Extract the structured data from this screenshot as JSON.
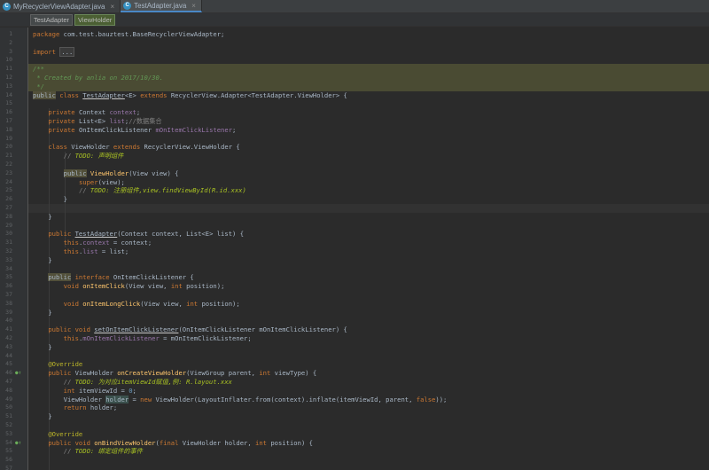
{
  "tabs": [
    {
      "icon": "C",
      "label": "MyRecyclerViewAdapter.java",
      "active": false
    },
    {
      "icon": "C",
      "label": "TestAdapter.java",
      "active": true
    }
  ],
  "breadcrumbs": [
    "TestAdapter",
    "ViewHolder"
  ],
  "lines": [
    {
      "n": "1",
      "code": [
        [
          "kw",
          "package "
        ],
        [
          "",
          "com.test.bauztest.BaseRecyclerViewAdapter;"
        ]
      ]
    },
    {
      "n": "2",
      "code": []
    },
    {
      "n": "3",
      "code": [
        [
          "kw",
          "import "
        ],
        [
          "fold",
          "..."
        ]
      ]
    },
    {
      "n": "10",
      "code": []
    },
    {
      "n": "11",
      "code": [
        [
          "doc",
          "/**"
        ]
      ]
    },
    {
      "n": "12",
      "code": [
        [
          "doc",
          " * Created by anlia on 2017/10/30."
        ]
      ]
    },
    {
      "n": "13",
      "code": [
        [
          "doc",
          " */"
        ]
      ]
    },
    {
      "n": "14",
      "code": [
        [
          "box2",
          "public"
        ],
        [
          "kw",
          " class "
        ],
        [
          "u",
          "TestAdapter"
        ],
        [
          "",
          "<E> "
        ],
        [
          "kw",
          "extends "
        ],
        [
          "",
          "RecyclerView.Adapter<TestAdapter.ViewHolder> {"
        ]
      ]
    },
    {
      "n": "15",
      "code": []
    },
    {
      "n": "16",
      "code": [
        [
          "",
          "    "
        ],
        [
          "kw",
          "private "
        ],
        [
          "",
          "Context "
        ],
        [
          "fld",
          "context"
        ],
        [
          "",
          ";"
        ]
      ]
    },
    {
      "n": "17",
      "code": [
        [
          "",
          "    "
        ],
        [
          "kw",
          "private "
        ],
        [
          "",
          "List<E> "
        ],
        [
          "fld",
          "list"
        ],
        [
          "",
          ";"
        ],
        [
          "cm",
          "//数据集合"
        ]
      ]
    },
    {
      "n": "18",
      "code": [
        [
          "",
          "    "
        ],
        [
          "kw",
          "private "
        ],
        [
          "",
          "OnItemClickListener "
        ],
        [
          "fld",
          "mOnItemClickListener"
        ],
        [
          "",
          ";"
        ]
      ]
    },
    {
      "n": "19",
      "code": []
    },
    {
      "n": "20",
      "code": [
        [
          "",
          "    "
        ],
        [
          "kw",
          "class "
        ],
        [
          "",
          "ViewHolder "
        ],
        [
          "kw",
          "extends "
        ],
        [
          "",
          "RecyclerView.ViewHolder {"
        ]
      ]
    },
    {
      "n": "21",
      "code": [
        [
          "",
          "        "
        ],
        [
          "cm",
          "// "
        ],
        [
          "todo",
          "TODO: 声明组件"
        ]
      ]
    },
    {
      "n": "22",
      "code": []
    },
    {
      "n": "23",
      "code": [
        [
          "",
          "        "
        ],
        [
          "box2",
          "public"
        ],
        [
          "",
          ""
        ],
        [
          "fn",
          " ViewHolder"
        ],
        [
          "",
          "(View view) {"
        ]
      ]
    },
    {
      "n": "24",
      "code": [
        [
          "",
          "            "
        ],
        [
          "kw",
          "super"
        ],
        [
          "",
          "(view);"
        ]
      ]
    },
    {
      "n": "25",
      "code": [
        [
          "",
          "            "
        ],
        [
          "cm",
          "// "
        ],
        [
          "todo",
          "TODO: 注册组件,view.findViewById(R.id.xxx)"
        ]
      ]
    },
    {
      "n": "26",
      "code": [
        [
          "",
          "        }"
        ]
      ]
    },
    {
      "n": "27",
      "code": []
    },
    {
      "n": "28",
      "code": [
        [
          "",
          "    }"
        ]
      ]
    },
    {
      "n": "29",
      "code": []
    },
    {
      "n": "30",
      "code": [
        [
          "",
          "    "
        ],
        [
          "kw",
          "public "
        ],
        [
          "u",
          "TestAdapter"
        ],
        [
          "",
          "(Context context, List<E> list) {"
        ]
      ]
    },
    {
      "n": "31",
      "code": [
        [
          "",
          "        "
        ],
        [
          "kw",
          "this"
        ],
        [
          "",
          "."
        ],
        [
          "fld",
          "context"
        ],
        [
          "",
          " = context;"
        ]
      ]
    },
    {
      "n": "32",
      "code": [
        [
          "",
          "        "
        ],
        [
          "kw",
          "this"
        ],
        [
          "",
          "."
        ],
        [
          "fld",
          "list"
        ],
        [
          "",
          " = list;"
        ]
      ]
    },
    {
      "n": "33",
      "code": [
        [
          "",
          "    }"
        ]
      ]
    },
    {
      "n": "34",
      "code": []
    },
    {
      "n": "35",
      "code": [
        [
          "",
          "    "
        ],
        [
          "box2",
          "public"
        ],
        [
          "kw",
          " interface "
        ],
        [
          "",
          "OnItemClickListener {"
        ]
      ]
    },
    {
      "n": "36",
      "code": [
        [
          "",
          "        "
        ],
        [
          "kw",
          "void "
        ],
        [
          "fn",
          "onItemClick"
        ],
        [
          "",
          "(View view, "
        ],
        [
          "kw",
          "int "
        ],
        [
          "",
          "position);"
        ]
      ]
    },
    {
      "n": "37",
      "code": []
    },
    {
      "n": "38",
      "code": [
        [
          "",
          "        "
        ],
        [
          "kw",
          "void "
        ],
        [
          "fn",
          "onItemLongClick"
        ],
        [
          "",
          "(View view, "
        ],
        [
          "kw",
          "int "
        ],
        [
          "",
          "position);"
        ]
      ]
    },
    {
      "n": "39",
      "code": [
        [
          "",
          "    }"
        ]
      ]
    },
    {
      "n": "40",
      "code": []
    },
    {
      "n": "41",
      "code": [
        [
          "",
          "    "
        ],
        [
          "kw",
          "public void "
        ],
        [
          "u",
          "setOnItemClickListener"
        ],
        [
          "",
          "(OnItemClickListener mOnItemClickListener) {"
        ]
      ]
    },
    {
      "n": "42",
      "code": [
        [
          "",
          "        "
        ],
        [
          "kw",
          "this"
        ],
        [
          "",
          "."
        ],
        [
          "fld",
          "mOnItemClickListener"
        ],
        [
          "",
          " = mOnItemClickListener;"
        ]
      ]
    },
    {
      "n": "43",
      "code": [
        [
          "",
          "    }"
        ]
      ]
    },
    {
      "n": "44",
      "code": []
    },
    {
      "n": "45",
      "code": [
        [
          "",
          "    "
        ],
        [
          "an",
          "@Override"
        ]
      ]
    },
    {
      "n": "46",
      "code": [
        [
          "",
          "    "
        ],
        [
          "kw",
          "public "
        ],
        [
          "",
          "ViewHolder "
        ],
        [
          "fn",
          "onCreateViewHolder"
        ],
        [
          "",
          "(ViewGroup parent, "
        ],
        [
          "kw",
          "int "
        ],
        [
          "",
          "viewType) {"
        ]
      ]
    },
    {
      "n": "47",
      "code": [
        [
          "",
          "        "
        ],
        [
          "cm",
          "// "
        ],
        [
          "todo",
          "TODO: 为对应itemViewId赋值,例: R.layout.xxx"
        ]
      ]
    },
    {
      "n": "48",
      "code": [
        [
          "",
          "        "
        ],
        [
          "kw",
          "int "
        ],
        [
          "",
          "itemViewId = "
        ],
        [
          "num",
          "0"
        ],
        [
          "",
          ";"
        ]
      ]
    },
    {
      "n": "49",
      "code": [
        [
          "",
          "        ViewHolder "
        ],
        [
          "box",
          "holder"
        ],
        [
          "",
          ""
        ],
        [
          "",
          ""
        ],
        [
          "",
          " = "
        ],
        [
          "kw",
          "new "
        ],
        [
          "",
          "ViewHolder(LayoutInflater."
        ],
        [
          "",
          "from"
        ],
        [
          "",
          "(context).inflate(itemViewId, parent, "
        ],
        [
          "kw",
          "false"
        ],
        [
          "",
          "));"
        ]
      ]
    },
    {
      "n": "50",
      "code": [
        [
          "",
          "        "
        ],
        [
          "kw",
          "return "
        ],
        [
          "",
          "holder;"
        ]
      ]
    },
    {
      "n": "51",
      "code": [
        [
          "",
          "    }"
        ]
      ]
    },
    {
      "n": "52",
      "code": []
    },
    {
      "n": "53",
      "code": [
        [
          "",
          "    "
        ],
        [
          "an",
          "@Override"
        ]
      ]
    },
    {
      "n": "54",
      "code": [
        [
          "",
          "    "
        ],
        [
          "kw",
          "public void "
        ],
        [
          "fn",
          "onBindViewHolder"
        ],
        [
          "",
          "("
        ],
        [
          "kw",
          "final "
        ],
        [
          "",
          "ViewHolder holder, "
        ],
        [
          "kw",
          "int "
        ],
        [
          "",
          "position) {"
        ]
      ]
    },
    {
      "n": "55",
      "code": [
        [
          "",
          "        "
        ],
        [
          "cm",
          "// "
        ],
        [
          "todo",
          "TODO: 绑定组件的事件"
        ]
      ]
    },
    {
      "n": "56",
      "code": []
    },
    {
      "n": "57",
      "code": []
    }
  ],
  "gutter_markers": [
    {
      "line": "46",
      "icon": "override-marker-icon",
      "glyph": "●↑"
    },
    {
      "line": "54",
      "icon": "override-marker-icon",
      "glyph": "●↑"
    }
  ]
}
